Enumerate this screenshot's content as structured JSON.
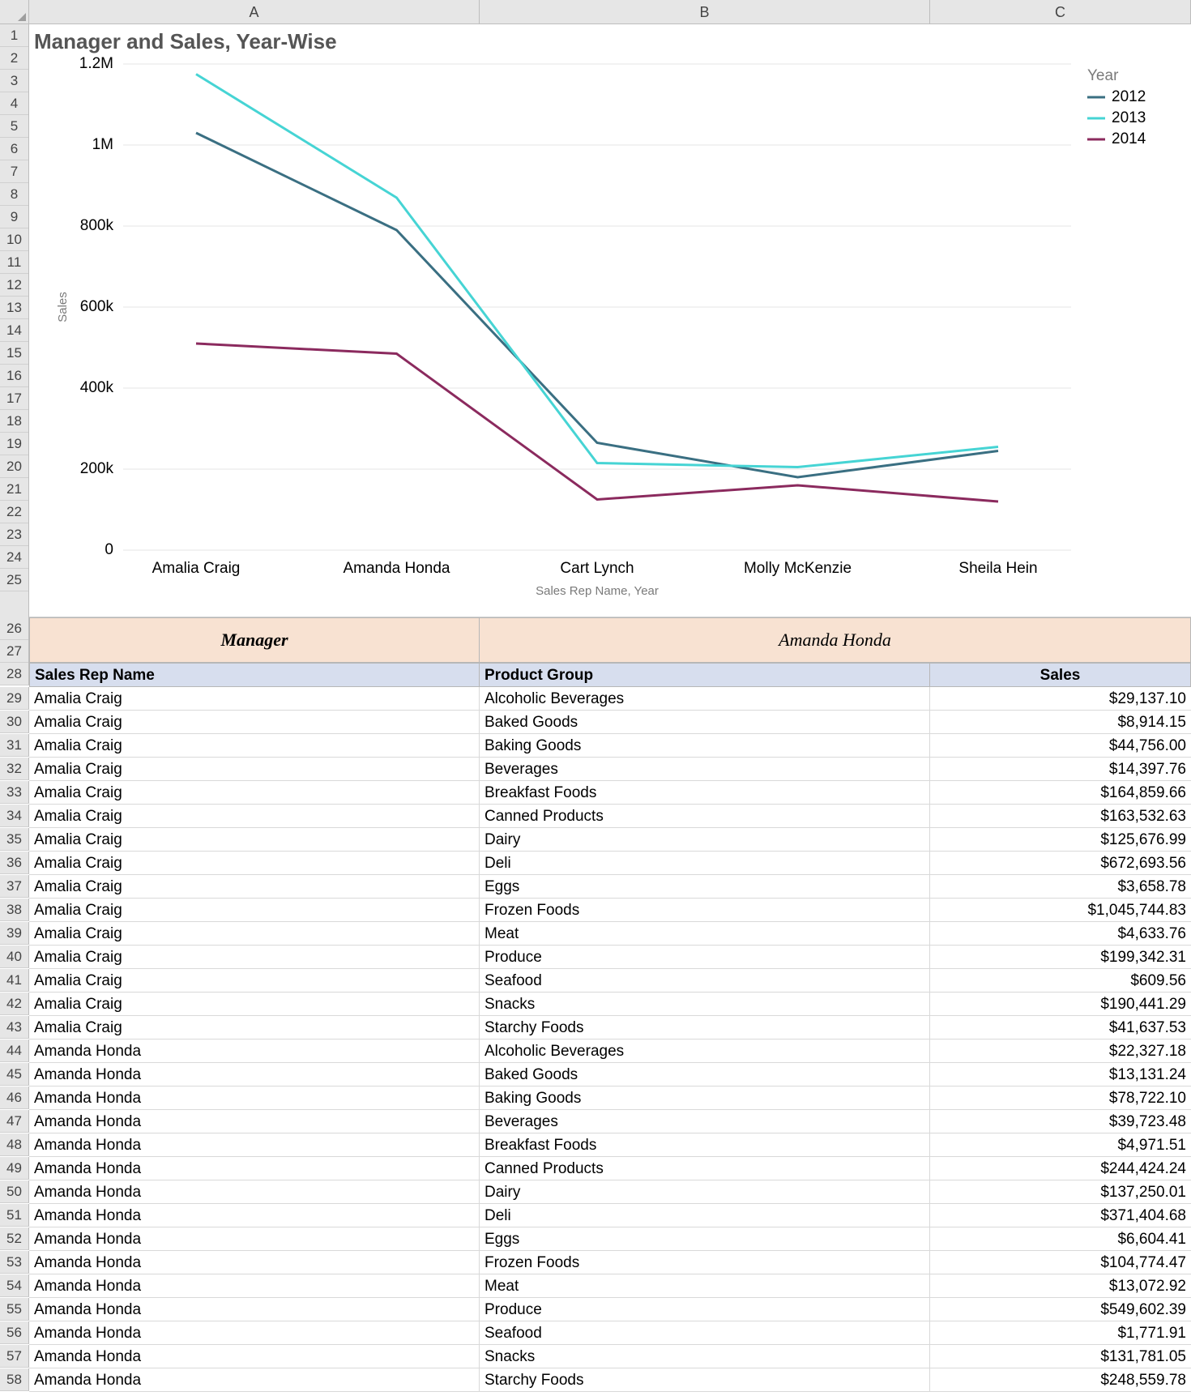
{
  "columns": [
    "A",
    "B",
    "C"
  ],
  "row_header_start": 1,
  "chart_row_count": 25,
  "chart_title": "Manager and Sales, Year-Wise",
  "chart_data": {
    "type": "line",
    "title": "Manager and Sales, Year-Wise",
    "xlabel": "Sales Rep Name, Year",
    "ylabel": "Sales",
    "ylim": [
      0,
      1200000
    ],
    "yticks": [
      0,
      200000,
      400000,
      600000,
      800000,
      1000000,
      1200000
    ],
    "ytick_labels": [
      "0",
      "200k",
      "400k",
      "600k",
      "800k",
      "1M",
      "1.2M"
    ],
    "categories": [
      "Amalia Craig",
      "Amanda Honda",
      "Cart Lynch",
      "Molly McKenzie",
      "Sheila Hein"
    ],
    "legend_title": "Year",
    "series": [
      {
        "name": "2012",
        "color": "#3a6f82",
        "values": [
          1030000,
          790000,
          265000,
          180000,
          245000
        ]
      },
      {
        "name": "2013",
        "color": "#46d4d4",
        "values": [
          1175000,
          870000,
          215000,
          205000,
          255000
        ]
      },
      {
        "name": "2014",
        "color": "#8b2a5e",
        "values": [
          510000,
          485000,
          125000,
          160000,
          120000
        ]
      }
    ]
  },
  "manager_band": {
    "label": "Manager",
    "value": "Amanda Honda"
  },
  "table": {
    "headers": [
      "Sales Rep Name",
      "Product Group",
      "Sales"
    ],
    "start_row": 29,
    "rows": [
      [
        "Amalia Craig",
        "Alcoholic Beverages",
        "$29,137.10"
      ],
      [
        "Amalia Craig",
        "Baked Goods",
        "$8,914.15"
      ],
      [
        "Amalia Craig",
        "Baking Goods",
        "$44,756.00"
      ],
      [
        "Amalia Craig",
        "Beverages",
        "$14,397.76"
      ],
      [
        "Amalia Craig",
        "Breakfast Foods",
        "$164,859.66"
      ],
      [
        "Amalia Craig",
        "Canned Products",
        "$163,532.63"
      ],
      [
        "Amalia Craig",
        "Dairy",
        "$125,676.99"
      ],
      [
        "Amalia Craig",
        "Deli",
        "$672,693.56"
      ],
      [
        "Amalia Craig",
        "Eggs",
        "$3,658.78"
      ],
      [
        "Amalia Craig",
        "Frozen Foods",
        "$1,045,744.83"
      ],
      [
        "Amalia Craig",
        "Meat",
        "$4,633.76"
      ],
      [
        "Amalia Craig",
        "Produce",
        "$199,342.31"
      ],
      [
        "Amalia Craig",
        "Seafood",
        "$609.56"
      ],
      [
        "Amalia Craig",
        "Snacks",
        "$190,441.29"
      ],
      [
        "Amalia Craig",
        "Starchy Foods",
        "$41,637.53"
      ],
      [
        "Amanda Honda",
        "Alcoholic Beverages",
        "$22,327.18"
      ],
      [
        "Amanda Honda",
        "Baked Goods",
        "$13,131.24"
      ],
      [
        "Amanda Honda",
        "Baking Goods",
        "$78,722.10"
      ],
      [
        "Amanda Honda",
        "Beverages",
        "$39,723.48"
      ],
      [
        "Amanda Honda",
        "Breakfast Foods",
        "$4,971.51"
      ],
      [
        "Amanda Honda",
        "Canned Products",
        "$244,424.24"
      ],
      [
        "Amanda Honda",
        "Dairy",
        "$137,250.01"
      ],
      [
        "Amanda Honda",
        "Deli",
        "$371,404.68"
      ],
      [
        "Amanda Honda",
        "Eggs",
        "$6,604.41"
      ],
      [
        "Amanda Honda",
        "Frozen Foods",
        "$104,774.47"
      ],
      [
        "Amanda Honda",
        "Meat",
        "$13,072.92"
      ],
      [
        "Amanda Honda",
        "Produce",
        "$549,602.39"
      ],
      [
        "Amanda Honda",
        "Seafood",
        "$1,771.91"
      ],
      [
        "Amanda Honda",
        "Snacks",
        "$131,781.05"
      ],
      [
        "Amanda Honda",
        "Starchy Foods",
        "$248,559.78"
      ]
    ]
  }
}
